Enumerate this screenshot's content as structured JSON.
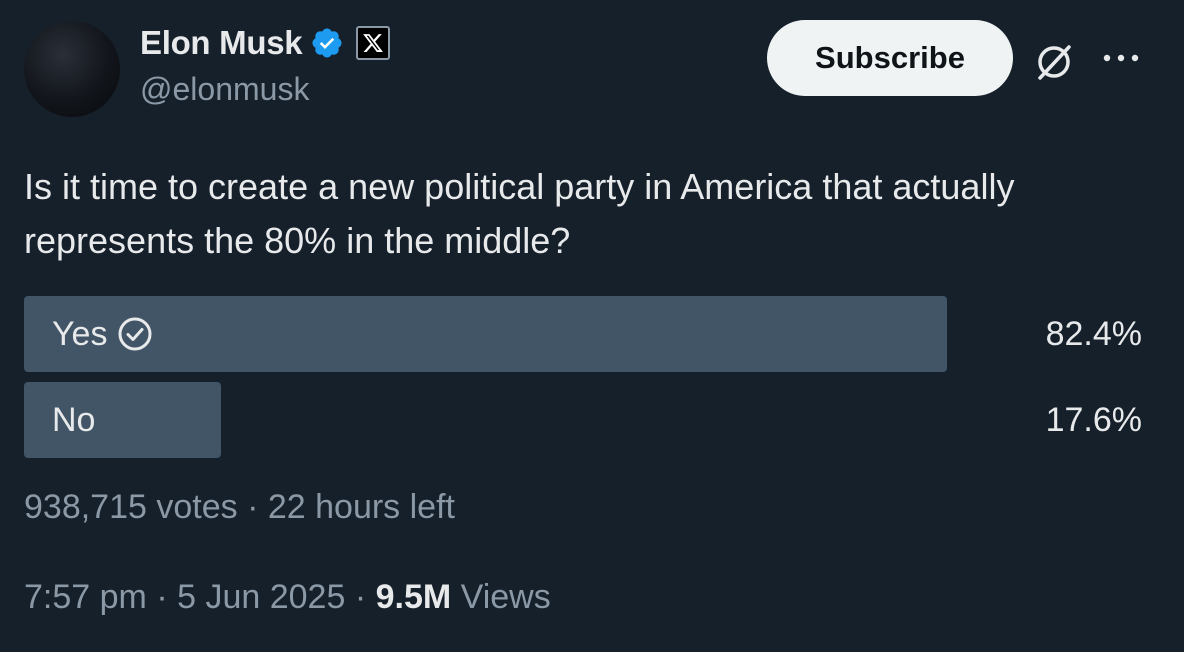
{
  "author": {
    "display_name": "Elon Musk",
    "handle": "@elonmusk",
    "verified_icon": "verified-badge-icon",
    "affiliate_icon": "x-logo-icon"
  },
  "actions": {
    "subscribe_label": "Subscribe",
    "grok_icon": "grok-icon",
    "more_icon": "more-icon"
  },
  "tweet": {
    "text": "Is it time to create a new political party in America that actually represents the 80% in the middle?"
  },
  "poll": {
    "options": [
      {
        "label": "Yes",
        "percent_text": "82.4%",
        "fraction": 0.824,
        "winner": true
      },
      {
        "label": "No",
        "percent_text": "17.6%",
        "fraction": 0.176,
        "winner": false
      }
    ],
    "votes": "938,715 votes",
    "separator": "·",
    "time_left": "22 hours left"
  },
  "meta": {
    "time": "7:57 pm",
    "date": "5 Jun 2025",
    "separator": "·",
    "views_count": "9.5M",
    "views_label": "Views"
  },
  "colors": {
    "background": "#15202b",
    "bar": "#425566",
    "verified": "#1d9bf0",
    "muted_text": "#8b98a5"
  }
}
